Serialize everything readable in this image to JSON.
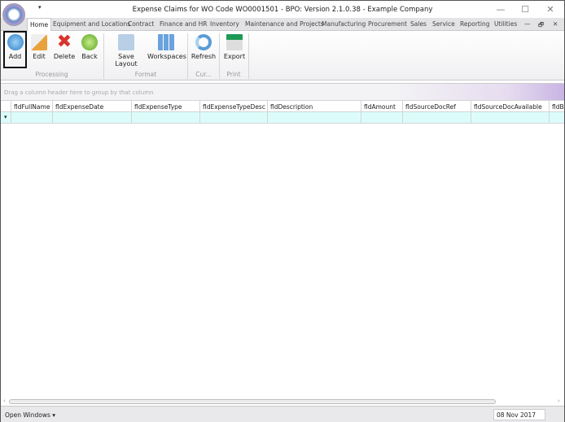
{
  "window": {
    "title": "Expense Claims for WO Code WO0001501 - BPO: Version 2.1.0.38 - Example Company",
    "minimize": "—",
    "maximize": "☐",
    "close": "✕",
    "qat": "▾"
  },
  "tabs": [
    "Home",
    "Equipment and Locations",
    "Contract",
    "Finance and HR",
    "Inventory",
    "Maintenance and Projects",
    "Manufacturing",
    "Procurement",
    "Sales",
    "Service",
    "Reporting",
    "Utilities"
  ],
  "mdi": {
    "minimize": "—",
    "restore": "🗗",
    "close": "✕"
  },
  "ribbon": {
    "buttons": [
      "Add",
      "Edit",
      "Delete",
      "Back",
      "Save Layout",
      "Workspaces",
      "Refresh",
      "Export"
    ],
    "groups": [
      "Processing",
      "Format",
      "Cur...",
      "Print"
    ]
  },
  "grid": {
    "group_hint": "Drag a column header here to group by that column",
    "columns": [
      "fldFullName",
      "fldExpenseDate",
      "fldExpenseType",
      "fldExpenseTypeDesc",
      "fldDescription",
      "fldAmount",
      "fldSourceDocRef",
      "fldSourceDocAvailable",
      "fldBill"
    ],
    "filter_icon": "funnel-icon"
  },
  "status": {
    "open_windows": "Open Windows ▾",
    "date": "08 Nov 2017"
  }
}
